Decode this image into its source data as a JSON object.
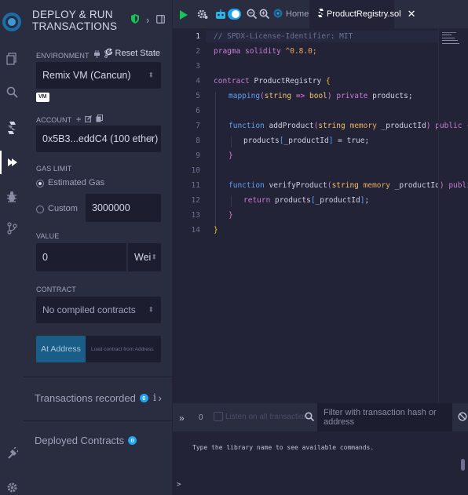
{
  "rail": {
    "items": [
      "logo-icon",
      "file-explorer-icon",
      "search-icon",
      "solidity-compiler-icon",
      "deploy-run-icon",
      "debugger-icon",
      "git-icon"
    ],
    "bottom_items": [
      "plugin-manager-icon",
      "settings-icon"
    ]
  },
  "panel": {
    "title": "DEPLOY & RUN TRANSACTIONS",
    "environment": {
      "label": "ENVIRONMENT",
      "reset_label": "Reset State",
      "value": "Remix VM (Cancun)",
      "badge": "VM"
    },
    "account": {
      "label": "ACCOUNT",
      "value": "0x5B3...eddC4 (100 ether)"
    },
    "gas_limit": {
      "label": "GAS LIMIT",
      "estimated_label": "Estimated Gas",
      "custom_label": "Custom",
      "custom_value": "3000000",
      "selected": "estimated"
    },
    "value": {
      "label": "VALUE",
      "amount": "0",
      "unit": "Wei"
    },
    "contract": {
      "label": "CONTRACT",
      "value": "No compiled contracts"
    },
    "at_address": {
      "button_label": "At Address",
      "placeholder": "Load contract from Address"
    },
    "transactions_recorded": {
      "label": "Transactions recorded",
      "count": "0",
      "info": "i"
    },
    "deployed_contracts": {
      "label": "Deployed Contracts",
      "count": "0"
    }
  },
  "tabs": {
    "home_label": "Home",
    "file_label": "ProductRegistry.sol"
  },
  "editor": {
    "line_numbers": [
      "1",
      "2",
      "3",
      "4",
      "5",
      "6",
      "7",
      "8",
      "9",
      "10",
      "11",
      "12",
      "13",
      "14"
    ],
    "lines": {
      "l1": "// SPDX-License-Identifier: MIT",
      "l2a": "pragma solidity ",
      "l2b": "^0.8.0;",
      "l4a": "contract ",
      "l4b": "ProductRegistry ",
      "l4c": "{",
      "l5a": "mapping",
      "l5b": "(",
      "l5c": "string",
      "l5d": " => ",
      "l5e": "bool",
      "l5f": ")",
      "l5g": " private ",
      "l5h": "products;",
      "l7a": "function ",
      "l7b": "addProduct",
      "l7c": "(",
      "l7d": "string ",
      "l7e": "memory ",
      "l7f": "_productId",
      "l7g": ")",
      "l7h": " public ",
      "l7i": "{",
      "l8a": "products",
      "l8b": "[",
      "l8c": "_productId",
      "l8d": "]",
      "l8e": " = ",
      "l8f": "true;",
      "l9": "}",
      "l11a": "function ",
      "l11b": "verifyProduct",
      "l11c": "(",
      "l11d": "string ",
      "l11e": "memory ",
      "l11f": "_productId",
      "l11g": ")",
      "l11h": " public",
      "l12a": "return ",
      "l12b": "products",
      "l12c": "[",
      "l12d": "_productId",
      "l12e": "]",
      "l12f": ";",
      "l13": "}",
      "l14": "}"
    }
  },
  "terminal": {
    "count": "0",
    "listen_label": "Listen on all transactions",
    "filter_placeholder": "Filter with transaction hash or address",
    "message": "Type the library name to see available commands.",
    "prompt": ">"
  },
  "colors": {
    "accent": "#1ea4f3",
    "run_green": "#15c455",
    "panel_bg": "#2a2c3f",
    "editor_bg": "#222336"
  }
}
